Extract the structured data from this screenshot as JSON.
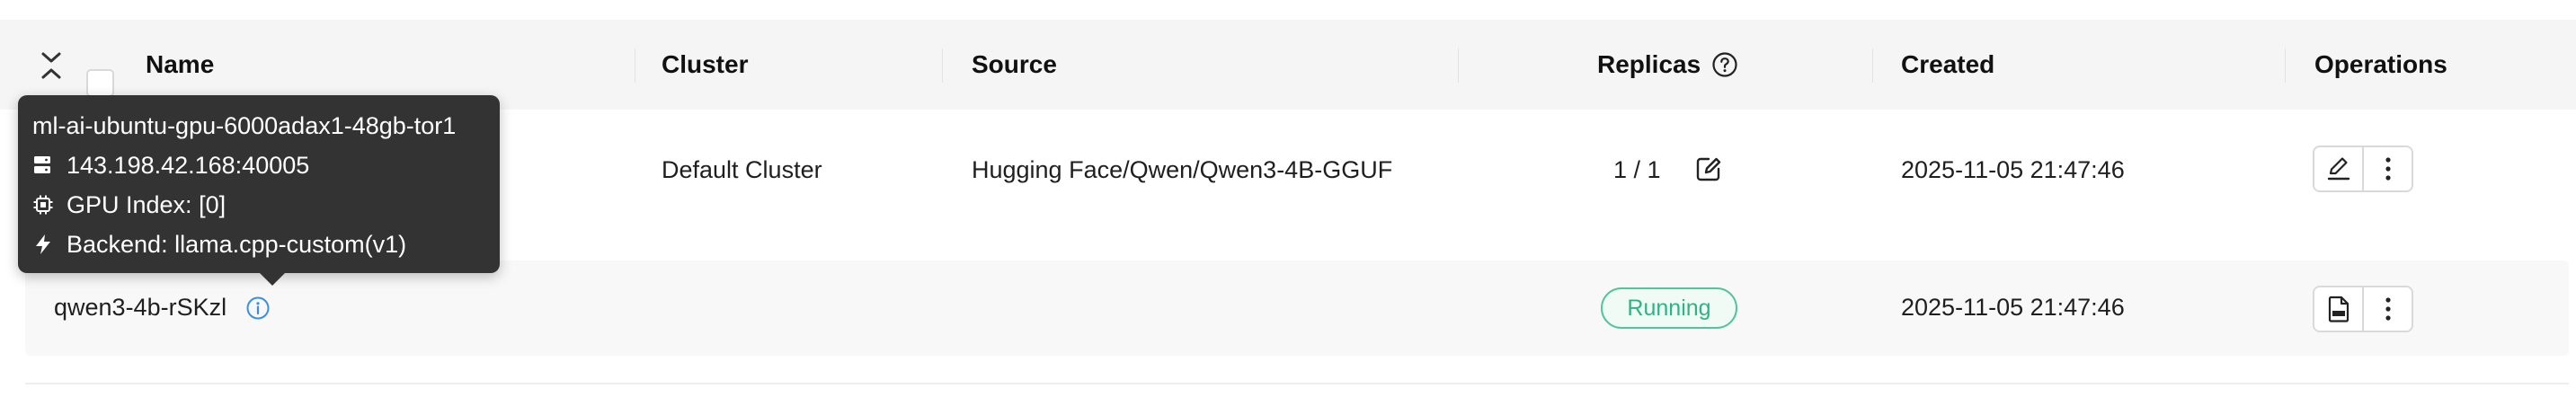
{
  "table": {
    "columns": {
      "name": "Name",
      "cluster": "Cluster",
      "source": "Source",
      "replicas": "Replicas",
      "created": "Created",
      "operations": "Operations"
    }
  },
  "model_row": {
    "cluster": "Default Cluster",
    "source": "Hugging Face/Qwen/Qwen3-4B-GGUF",
    "replicas": "1 / 1",
    "created": "2025-11-05 21:47:46"
  },
  "instance_row": {
    "name": "qwen3-4b-rSKzl",
    "status": "Running",
    "created": "2025-11-05 21:47:46"
  },
  "tooltip": {
    "worker": "ml-ai-ubuntu-gpu-6000adax1-48gb-tor1",
    "address": "143.198.42.168:40005",
    "gpu_index": "GPU Index: [0]",
    "backend": "Backend: llama.cpp-custom(v1)"
  },
  "icons": {
    "expand": "expand-collapse-icon",
    "help": "help-circle-icon",
    "edit": "edit-icon",
    "more": "more-vertical-icon",
    "log": "log-file-icon",
    "info": "info-icon",
    "server": "server-icon",
    "chip": "chip-icon",
    "bolt": "bolt-icon"
  },
  "colors": {
    "running": "#2fb383",
    "info_icon": "#3a8ee6",
    "tooltip_bg": "#333333",
    "header_bg": "#f5f5f5"
  }
}
